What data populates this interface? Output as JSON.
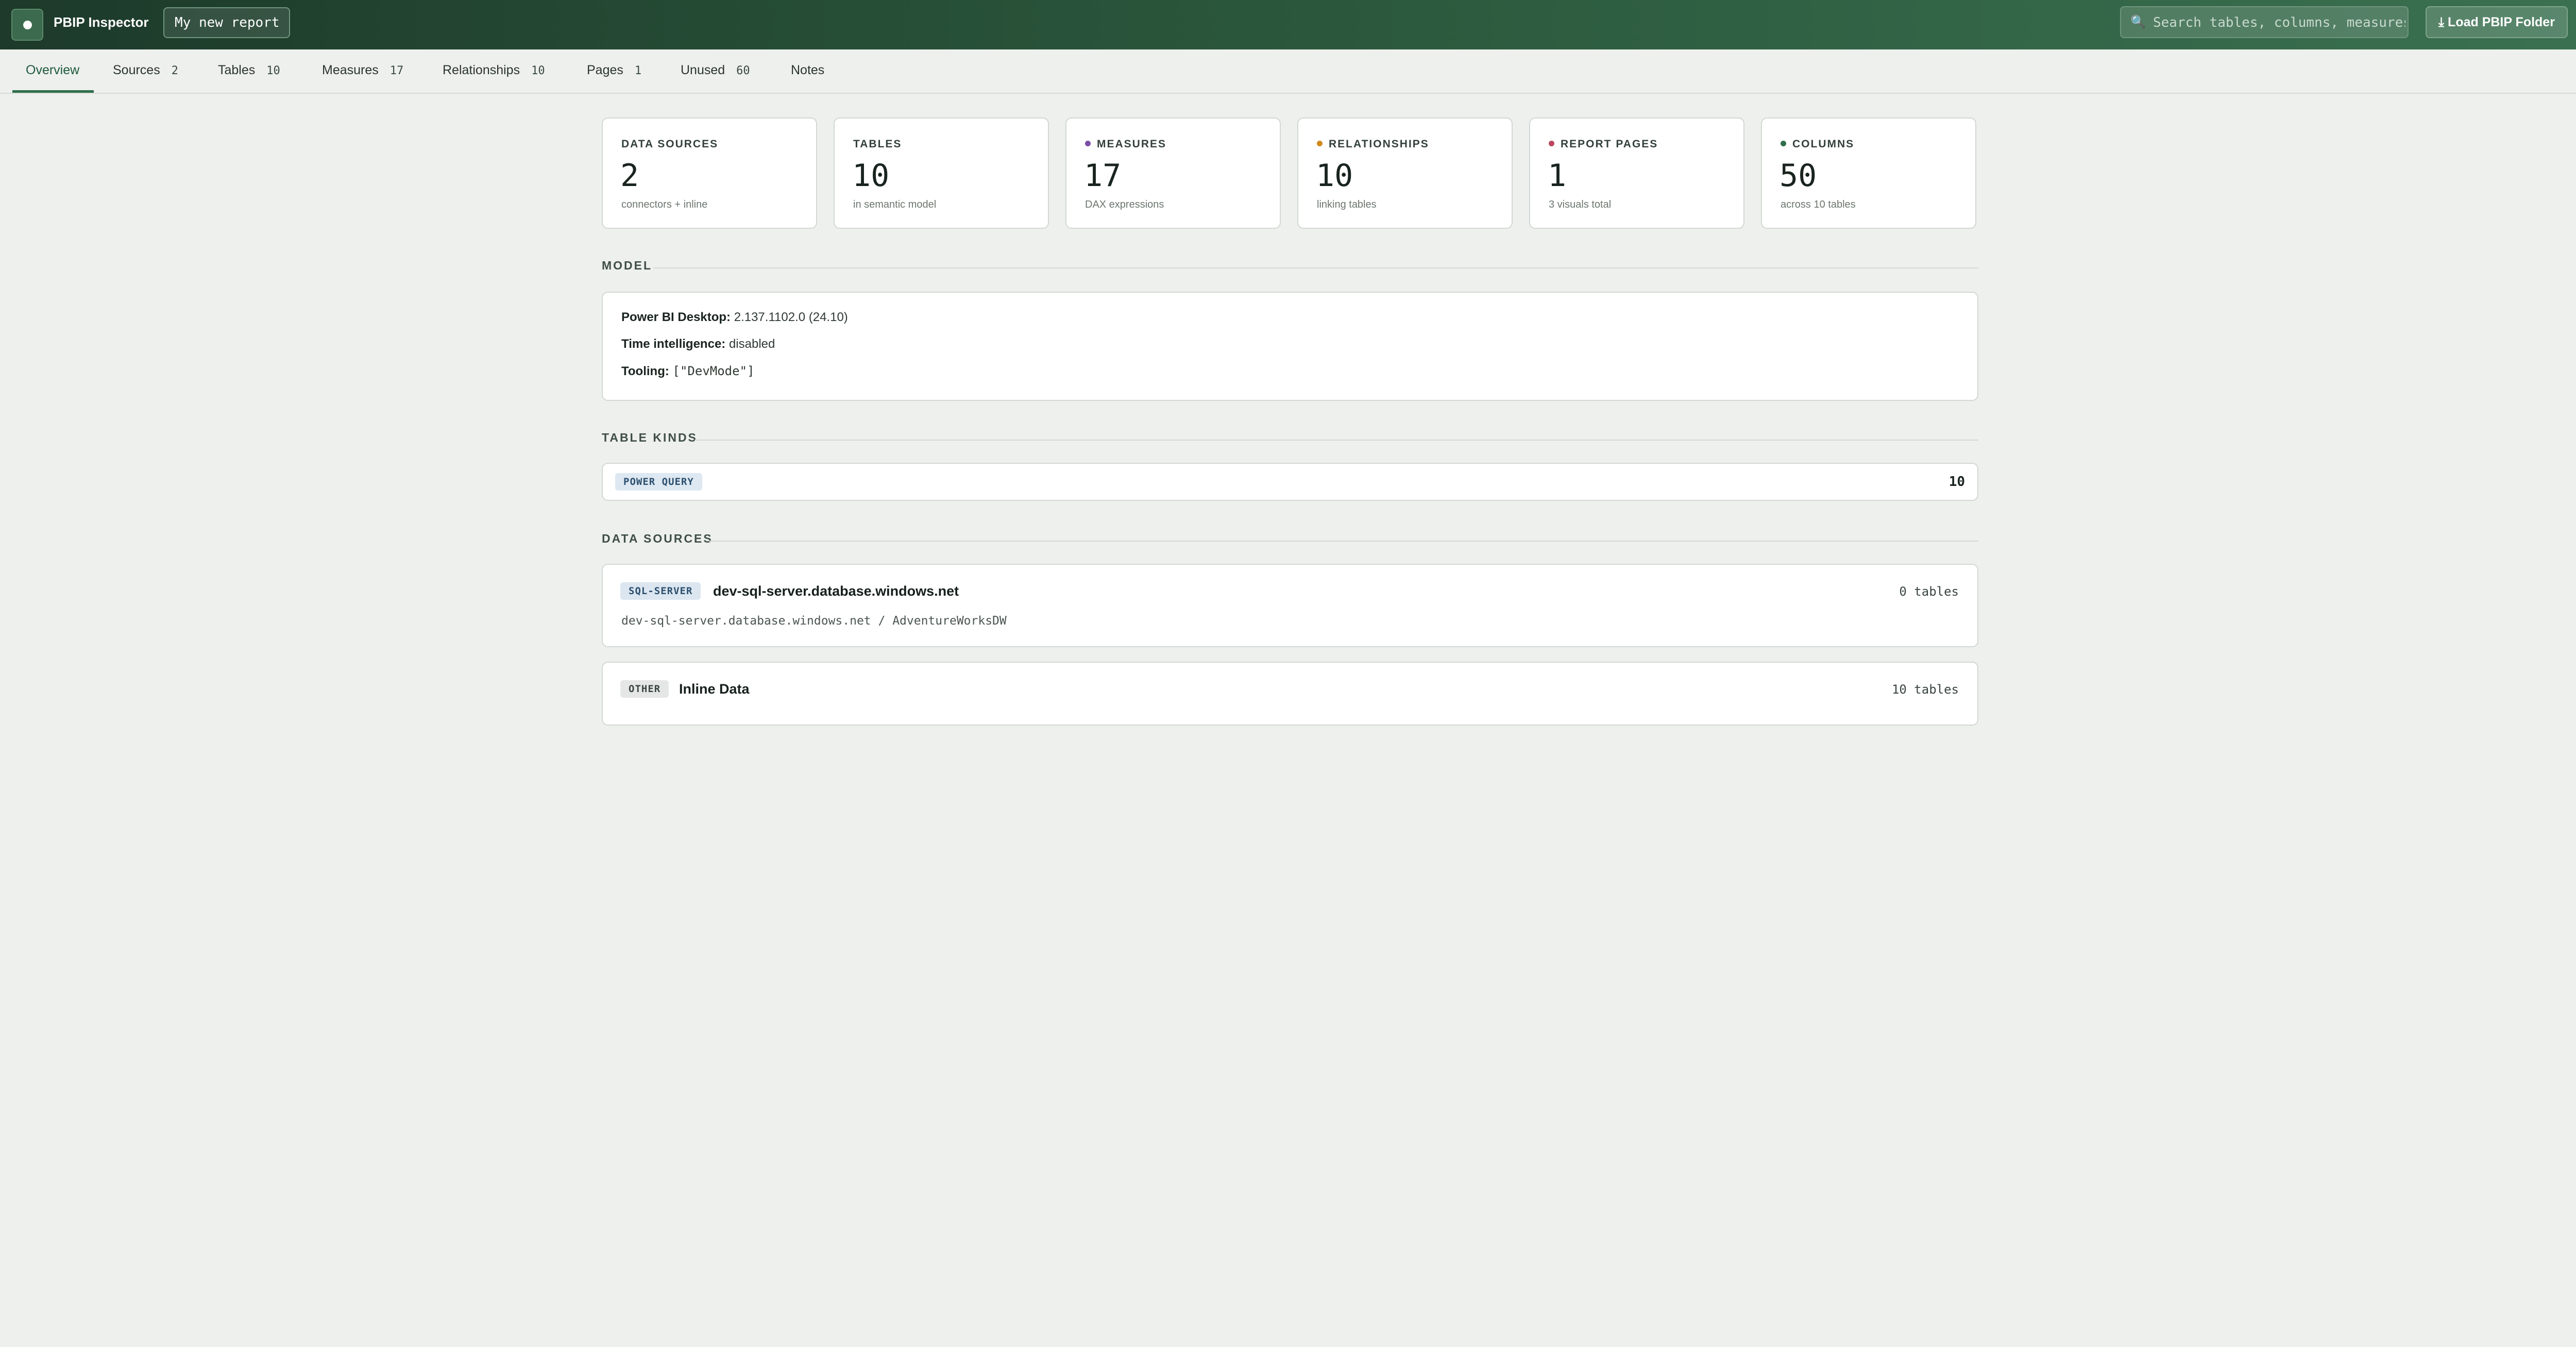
{
  "header": {
    "app_title": "PBIP Inspector",
    "report_name": "My new report",
    "search_placeholder": "Search tables, columns, measures,",
    "load_button": "⤓ Load PBIP Folder"
  },
  "tabs": [
    {
      "label": "Overview",
      "count": ""
    },
    {
      "label": "Sources",
      "count": "2"
    },
    {
      "label": "Tables",
      "count": "10"
    },
    {
      "label": "Measures",
      "count": "17"
    },
    {
      "label": "Relationships",
      "count": "10"
    },
    {
      "label": "Pages",
      "count": "1"
    },
    {
      "label": "Unused",
      "count": "60"
    },
    {
      "label": "Notes",
      "count": ""
    }
  ],
  "stats": [
    {
      "label": "DATA SOURCES",
      "value": "2",
      "sub": "connectors + inline",
      "dot_color": ""
    },
    {
      "label": "TABLES",
      "value": "10",
      "sub": "in semantic model",
      "dot_color": ""
    },
    {
      "label": "MEASURES",
      "value": "17",
      "sub": "DAX expressions",
      "dot_color": "#7b4fa6"
    },
    {
      "label": "RELATIONSHIPS",
      "value": "10",
      "sub": "linking tables",
      "dot_color": "#d08a1c"
    },
    {
      "label": "REPORT PAGES",
      "value": "1",
      "sub": "3 visuals total",
      "dot_color": "#b9485f"
    },
    {
      "label": "COLUMNS",
      "value": "50",
      "sub": "across 10 tables",
      "dot_color": "#2f6e4b"
    }
  ],
  "sections": {
    "model": "MODEL",
    "table_kinds": "TABLE KINDS",
    "data_sources": "DATA SOURCES"
  },
  "model": {
    "desktop_label": "Power BI Desktop:",
    "desktop_value": "2.137.1102.0 (24.10)",
    "time_label": "Time intelligence:",
    "time_value": "disabled",
    "tooling_label": "Tooling:",
    "tooling_value": "[\"DevMode\"]"
  },
  "table_kinds": [
    {
      "kind": "POWER QUERY",
      "count": "10"
    }
  ],
  "data_sources": [
    {
      "type": "SQL-SERVER",
      "name": "dev-sql-server.database.windows.net",
      "detail": "dev-sql-server.database.windows.net / AdventureWorksDW",
      "tables": "0 tables"
    },
    {
      "type": "OTHER",
      "name": "Inline Data",
      "detail": "",
      "tables": "10 tables"
    }
  ],
  "colors": {
    "header_start": "#1d3a2a",
    "header_end": "#3a7050",
    "accent": "#2f6e4b",
    "background": "#eef0ee"
  }
}
